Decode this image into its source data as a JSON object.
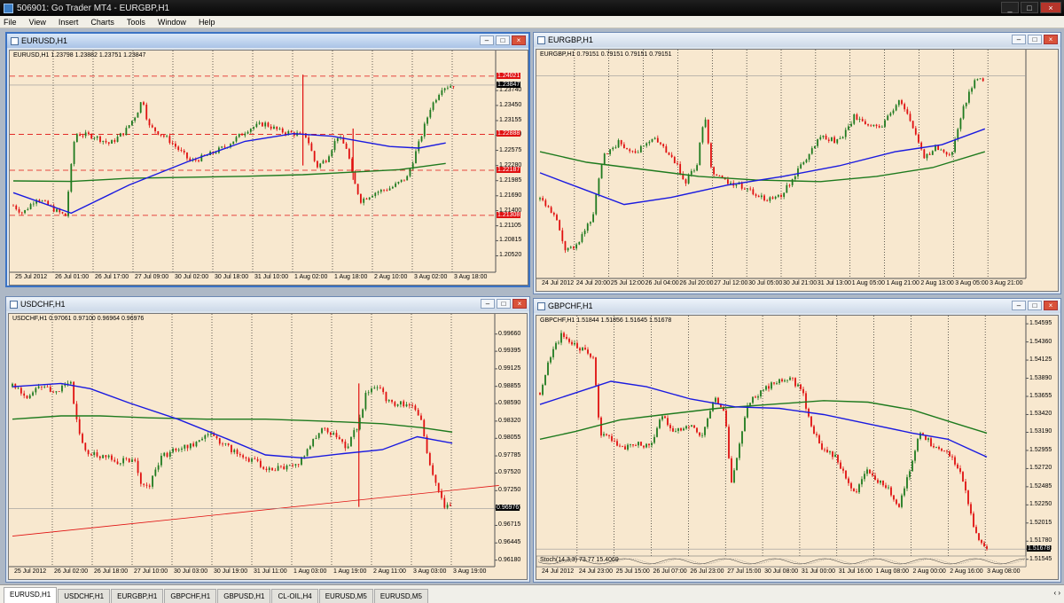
{
  "app": {
    "title": "506901: Go Trader MT4 - EURGBP,H1",
    "window_controls": [
      "_",
      "□",
      "×"
    ]
  },
  "menu": [
    "File",
    "View",
    "Insert",
    "Charts",
    "Tools",
    "Window",
    "Help"
  ],
  "child_controls": [
    "–",
    "□",
    "×"
  ],
  "colors": {
    "bg": "#f8e8cf",
    "bull": "#1f7a1f",
    "bear": "#e01010",
    "ma_fast": "#1a1ae0",
    "ma_slow": "#1e7a1e",
    "hline": "#e01010",
    "grid": "#000000"
  },
  "charts": [
    {
      "id": "eurusd",
      "title": "EURUSD,H1",
      "active": true,
      "info": "EURUSD,H1  1.23798 1.23882 1.23751 1.23847",
      "ymin": 1.202,
      "ymax": 1.2452,
      "yticks": [
        "1.23740",
        "1.23450",
        "1.23155",
        "1.22870",
        "1.22575",
        "1.22280",
        "1.21985",
        "1.21690",
        "1.21400",
        "1.21105",
        "1.20815",
        "1.20520"
      ],
      "ytick_vals": [
        1.2374,
        1.2345,
        1.23155,
        1.2287,
        1.22575,
        1.2228,
        1.21985,
        1.2169,
        1.214,
        1.21105,
        1.20815,
        1.2052
      ],
      "xlabels": [
        "25 Jul 2012",
        "26 Jul 01:00",
        "26 Jul 17:00",
        "27 Jul 09:00",
        "30 Jul 02:00",
        "30 Jul 18:00",
        "31 Jul 10:00",
        "1 Aug 02:00",
        "1 Aug 18:00",
        "2 Aug 10:00",
        "3 Aug 02:00",
        "3 Aug 18:00"
      ],
      "hlines": [
        {
          "value": 1.24021,
          "label": "1.24021"
        },
        {
          "value": 1.22888,
          "label": "1.22888"
        },
        {
          "value": 1.22187,
          "label": "1.22187"
        },
        {
          "value": 1.21308,
          "label": "1.21308"
        }
      ],
      "price": {
        "value": 1.23847,
        "label": "1.23847"
      },
      "path": [
        [
          0,
          1.215
        ],
        [
          5,
          1.2135
        ],
        [
          12,
          1.2165
        ],
        [
          22,
          1.214
        ],
        [
          27,
          1.213
        ],
        [
          32,
          1.229
        ],
        [
          42,
          1.2285
        ],
        [
          50,
          1.227
        ],
        [
          58,
          1.2295
        ],
        [
          64,
          1.233
        ],
        [
          67,
          1.236
        ],
        [
          70,
          1.2305
        ],
        [
          80,
          1.228
        ],
        [
          92,
          1.2235
        ],
        [
          102,
          1.225
        ],
        [
          110,
          1.2265
        ],
        [
          122,
          1.23
        ],
        [
          130,
          1.231
        ],
        [
          138,
          1.2295
        ],
        [
          146,
          1.229
        ],
        [
          152,
          1.2285
        ],
        [
          157,
          1.2225
        ],
        [
          162,
          1.224
        ],
        [
          168,
          1.2285
        ],
        [
          173,
          1.226
        ],
        [
          176,
          1.22
        ],
        [
          180,
          1.216
        ],
        [
          187,
          1.2175
        ],
        [
          196,
          1.2185
        ],
        [
          204,
          1.2205
        ],
        [
          210,
          1.227
        ],
        [
          216,
          1.234
        ],
        [
          222,
          1.238
        ],
        [
          228,
          1.2385
        ]
      ],
      "ma_fast": [
        [
          0,
          1.2175
        ],
        [
          30,
          1.2135
        ],
        [
          60,
          1.219
        ],
        [
          90,
          1.2235
        ],
        [
          120,
          1.2275
        ],
        [
          145,
          1.229
        ],
        [
          165,
          1.2285
        ],
        [
          180,
          1.2275
        ],
        [
          195,
          1.2265
        ],
        [
          210,
          1.2262
        ],
        [
          224,
          1.2272
        ]
      ],
      "ma_slow": [
        [
          0,
          1.2198
        ],
        [
          30,
          1.2197
        ],
        [
          60,
          1.2203
        ],
        [
          90,
          1.2205
        ],
        [
          120,
          1.2207
        ],
        [
          150,
          1.221
        ],
        [
          175,
          1.2215
        ],
        [
          200,
          1.222
        ],
        [
          224,
          1.2232
        ]
      ],
      "spikes": [
        [
          150,
          1.2405,
          1.2228
        ],
        [
          176,
          1.23,
          1.22
        ]
      ]
    },
    {
      "id": "eurgbp",
      "title": "EURGBP,H1",
      "active": false,
      "info": "EURGBP,H1  0.79151 0.79151 0.79151 0.79151",
      "ymin": 0.78,
      "ymax": 0.793,
      "yticks": [],
      "ytick_vals": [],
      "xlabels": [
        "24 Jul 2012",
        "24 Jul 20:00",
        "25 Jul 12:00",
        "26 Jul 04:00",
        "26 Jul 20:00",
        "27 Jul 12:00",
        "30 Jul 05:00",
        "30 Jul 21:00",
        "31 Jul 13:00",
        "1 Aug 05:00",
        "1 Aug 21:00",
        "2 Aug 13:00",
        "3 Aug 05:00",
        "3 Aug 21:00"
      ],
      "hlines": [],
      "price": {
        "value": 0.79151,
        "label": ""
      },
      "path": [
        [
          0,
          0.7845
        ],
        [
          8,
          0.7835
        ],
        [
          14,
          0.7815
        ],
        [
          20,
          0.782
        ],
        [
          28,
          0.7835
        ],
        [
          34,
          0.787
        ],
        [
          42,
          0.7877
        ],
        [
          52,
          0.7872
        ],
        [
          60,
          0.788
        ],
        [
          70,
          0.787
        ],
        [
          78,
          0.7855
        ],
        [
          84,
          0.7865
        ],
        [
          88,
          0.7895
        ],
        [
          92,
          0.786
        ],
        [
          100,
          0.7855
        ],
        [
          110,
          0.7852
        ],
        [
          120,
          0.7845
        ],
        [
          130,
          0.7848
        ],
        [
          140,
          0.7865
        ],
        [
          150,
          0.788
        ],
        [
          160,
          0.7878
        ],
        [
          168,
          0.7892
        ],
        [
          176,
          0.7885
        ],
        [
          184,
          0.7888
        ],
        [
          192,
          0.7902
        ],
        [
          200,
          0.7885
        ],
        [
          206,
          0.7868
        ],
        [
          212,
          0.7875
        ],
        [
          220,
          0.787
        ],
        [
          226,
          0.7895
        ],
        [
          232,
          0.7912
        ],
        [
          238,
          0.7914
        ]
      ],
      "ma_fast": [
        [
          0,
          0.786
        ],
        [
          20,
          0.7852
        ],
        [
          45,
          0.7842
        ],
        [
          70,
          0.7846
        ],
        [
          100,
          0.7853
        ],
        [
          130,
          0.7858
        ],
        [
          160,
          0.7864
        ],
        [
          190,
          0.7872
        ],
        [
          215,
          0.7876
        ],
        [
          238,
          0.7885
        ]
      ],
      "ma_slow": [
        [
          0,
          0.7872
        ],
        [
          25,
          0.7866
        ],
        [
          55,
          0.7862
        ],
        [
          85,
          0.7858
        ],
        [
          115,
          0.7856
        ],
        [
          150,
          0.7855
        ],
        [
          180,
          0.7858
        ],
        [
          210,
          0.7863
        ],
        [
          238,
          0.7872
        ]
      ],
      "spikes": []
    },
    {
      "id": "usdchf",
      "title": "USDCHF,H1",
      "active": false,
      "info": "USDCHF,H1  0.97061 0.97100 0.96964 0.96976",
      "ymin": 0.9608,
      "ymax": 0.9997,
      "yticks": [
        "0.99930",
        "0.99660",
        "0.99395",
        "0.99125",
        "0.98855",
        "0.98590",
        "0.98320",
        "0.98055",
        "0.97785",
        "0.97520",
        "0.97250",
        "0.96976",
        "0.96715",
        "0.96445",
        "0.96180"
      ],
      "ytick_vals": [
        0.9993,
        0.9966,
        0.99395,
        0.99125,
        0.98855,
        0.9859,
        0.9832,
        0.98055,
        0.97785,
        0.9752,
        0.9725,
        0.96976,
        0.96715,
        0.96445,
        0.9618
      ],
      "xlabels": [
        "25 Jul 2012",
        "26 Jul 02:00",
        "26 Jul 18:00",
        "27 Jul 10:00",
        "30 Jul 03:00",
        "30 Jul 19:00",
        "31 Jul 11:00",
        "1 Aug 03:00",
        "1 Aug 19:00",
        "2 Aug 11:00",
        "3 Aug 03:00",
        "3 Aug 19:00"
      ],
      "hlines": [],
      "price": {
        "value": 0.96976,
        "label": "0.96976"
      },
      "trendline": [
        [
          0,
          0.9655
        ],
        [
          250,
          0.9733
        ]
      ],
      "path": [
        [
          0,
          0.9885
        ],
        [
          8,
          0.987
        ],
        [
          14,
          0.9888
        ],
        [
          22,
          0.9878
        ],
        [
          30,
          0.989
        ],
        [
          33,
          0.983
        ],
        [
          38,
          0.9785
        ],
        [
          46,
          0.9778
        ],
        [
          54,
          0.977
        ],
        [
          62,
          0.9775
        ],
        [
          66,
          0.974
        ],
        [
          70,
          0.973
        ],
        [
          76,
          0.9775
        ],
        [
          84,
          0.979
        ],
        [
          92,
          0.9795
        ],
        [
          100,
          0.981
        ],
        [
          108,
          0.98
        ],
        [
          116,
          0.978
        ],
        [
          124,
          0.977
        ],
        [
          132,
          0.9758
        ],
        [
          140,
          0.9762
        ],
        [
          148,
          0.977
        ],
        [
          154,
          0.98
        ],
        [
          160,
          0.982
        ],
        [
          166,
          0.981
        ],
        [
          172,
          0.979
        ],
        [
          178,
          0.983
        ],
        [
          182,
          0.988
        ],
        [
          188,
          0.9885
        ],
        [
          194,
          0.9858
        ],
        [
          204,
          0.986
        ],
        [
          210,
          0.983
        ],
        [
          214,
          0.977
        ],
        [
          218,
          0.973
        ],
        [
          222,
          0.97
        ],
        [
          226,
          0.9698
        ]
      ],
      "ma_fast": [
        [
          0,
          0.9885
        ],
        [
          25,
          0.989
        ],
        [
          40,
          0.9882
        ],
        [
          60,
          0.986
        ],
        [
          85,
          0.9835
        ],
        [
          110,
          0.9805
        ],
        [
          130,
          0.978
        ],
        [
          150,
          0.9775
        ],
        [
          170,
          0.9782
        ],
        [
          190,
          0.9788
        ],
        [
          208,
          0.9808
        ],
        [
          226,
          0.9798
        ]
      ],
      "ma_slow": [
        [
          0,
          0.9835
        ],
        [
          25,
          0.984
        ],
        [
          45,
          0.984
        ],
        [
          70,
          0.9837
        ],
        [
          100,
          0.9835
        ],
        [
          130,
          0.9835
        ],
        [
          160,
          0.9832
        ],
        [
          190,
          0.9828
        ],
        [
          210,
          0.9822
        ],
        [
          226,
          0.9815
        ]
      ],
      "spikes": [
        [
          178,
          0.989,
          0.97
        ]
      ]
    },
    {
      "id": "gbpchf",
      "title": "GBPCHF,H1",
      "active": false,
      "info": "GBPCHF,H1  1.51844 1.51856 1.51645 1.51678",
      "ymin": 1.5145,
      "ymax": 1.547,
      "yticks": [
        "1.54595",
        "1.54360",
        "1.54125",
        "1.53890",
        "1.53655",
        "1.53420",
        "1.53190",
        "1.52955",
        "1.52720",
        "1.52485",
        "1.52250",
        "1.52015",
        "1.51780",
        "1.51678",
        "1.51545"
      ],
      "ytick_vals": [
        1.54595,
        1.5436,
        1.54125,
        1.5389,
        1.53655,
        1.5342,
        1.5319,
        1.52955,
        1.5272,
        1.52485,
        1.5225,
        1.52015,
        1.5178,
        1.51678,
        1.51545
      ],
      "xlabels": [
        "24 Jul 2012",
        "24 Jul 23:00",
        "25 Jul 15:00",
        "26 Jul 07:00",
        "26 Jul 23:00",
        "27 Jul 15:00",
        "30 Jul 08:00",
        "31 Jul 00:00",
        "31 Jul 16:00",
        "1 Aug 08:00",
        "2 Aug 00:00",
        "2 Aug 16:00",
        "3 Aug 08:00"
      ],
      "hlines": [],
      "price": {
        "value": 1.51678,
        "label": "1.51678"
      },
      "indicator_label": "Stoch(14,3,3) 73.77 15.4069",
      "path": [
        [
          0,
          1.537
        ],
        [
          6,
          1.542
        ],
        [
          12,
          1.5445
        ],
        [
          18,
          1.5435
        ],
        [
          24,
          1.5425
        ],
        [
          30,
          1.5415
        ],
        [
          34,
          1.5315
        ],
        [
          40,
          1.531
        ],
        [
          48,
          1.53
        ],
        [
          56,
          1.5305
        ],
        [
          62,
          1.53
        ],
        [
          68,
          1.534
        ],
        [
          76,
          1.532
        ],
        [
          84,
          1.533
        ],
        [
          92,
          1.5315
        ],
        [
          98,
          1.5365
        ],
        [
          104,
          1.5345
        ],
        [
          108,
          1.5255
        ],
        [
          112,
          1.53
        ],
        [
          118,
          1.536
        ],
        [
          126,
          1.5375
        ],
        [
          134,
          1.5385
        ],
        [
          142,
          1.5388
        ],
        [
          148,
          1.537
        ],
        [
          154,
          1.532
        ],
        [
          160,
          1.5295
        ],
        [
          166,
          1.529
        ],
        [
          172,
          1.5265
        ],
        [
          178,
          1.524
        ],
        [
          184,
          1.5275
        ],
        [
          190,
          1.5255
        ],
        [
          196,
          1.525
        ],
        [
          202,
          1.522
        ],
        [
          208,
          1.5265
        ],
        [
          214,
          1.532
        ],
        [
          220,
          1.5305
        ],
        [
          226,
          1.53
        ],
        [
          232,
          1.5285
        ],
        [
          238,
          1.526
        ],
        [
          244,
          1.52
        ],
        [
          248,
          1.518
        ],
        [
          252,
          1.517
        ]
      ],
      "ma_fast": [
        [
          0,
          1.5355
        ],
        [
          20,
          1.537
        ],
        [
          40,
          1.5385
        ],
        [
          60,
          1.5378
        ],
        [
          85,
          1.5362
        ],
        [
          110,
          1.5352
        ],
        [
          135,
          1.535
        ],
        [
          160,
          1.5342
        ],
        [
          185,
          1.533
        ],
        [
          210,
          1.5318
        ],
        [
          230,
          1.531
        ],
        [
          252,
          1.5287
        ]
      ],
      "ma_slow": [
        [
          0,
          1.531
        ],
        [
          20,
          1.532
        ],
        [
          45,
          1.5335
        ],
        [
          70,
          1.5342
        ],
        [
          100,
          1.535
        ],
        [
          130,
          1.5355
        ],
        [
          160,
          1.536
        ],
        [
          185,
          1.5358
        ],
        [
          210,
          1.5348
        ],
        [
          235,
          1.533
        ],
        [
          252,
          1.5318
        ]
      ],
      "spikes": []
    }
  ],
  "tabs": [
    "EURUSD,H1",
    "USDCHF,H1",
    "EURGBP,H1",
    "GBPCHF,H1",
    "GBPUSD,H1",
    "CL-OIL,H4",
    "EURUSD,M5",
    "EURUSD,M5"
  ],
  "selected_tab": 0,
  "tab_arrows": "‹ ›"
}
